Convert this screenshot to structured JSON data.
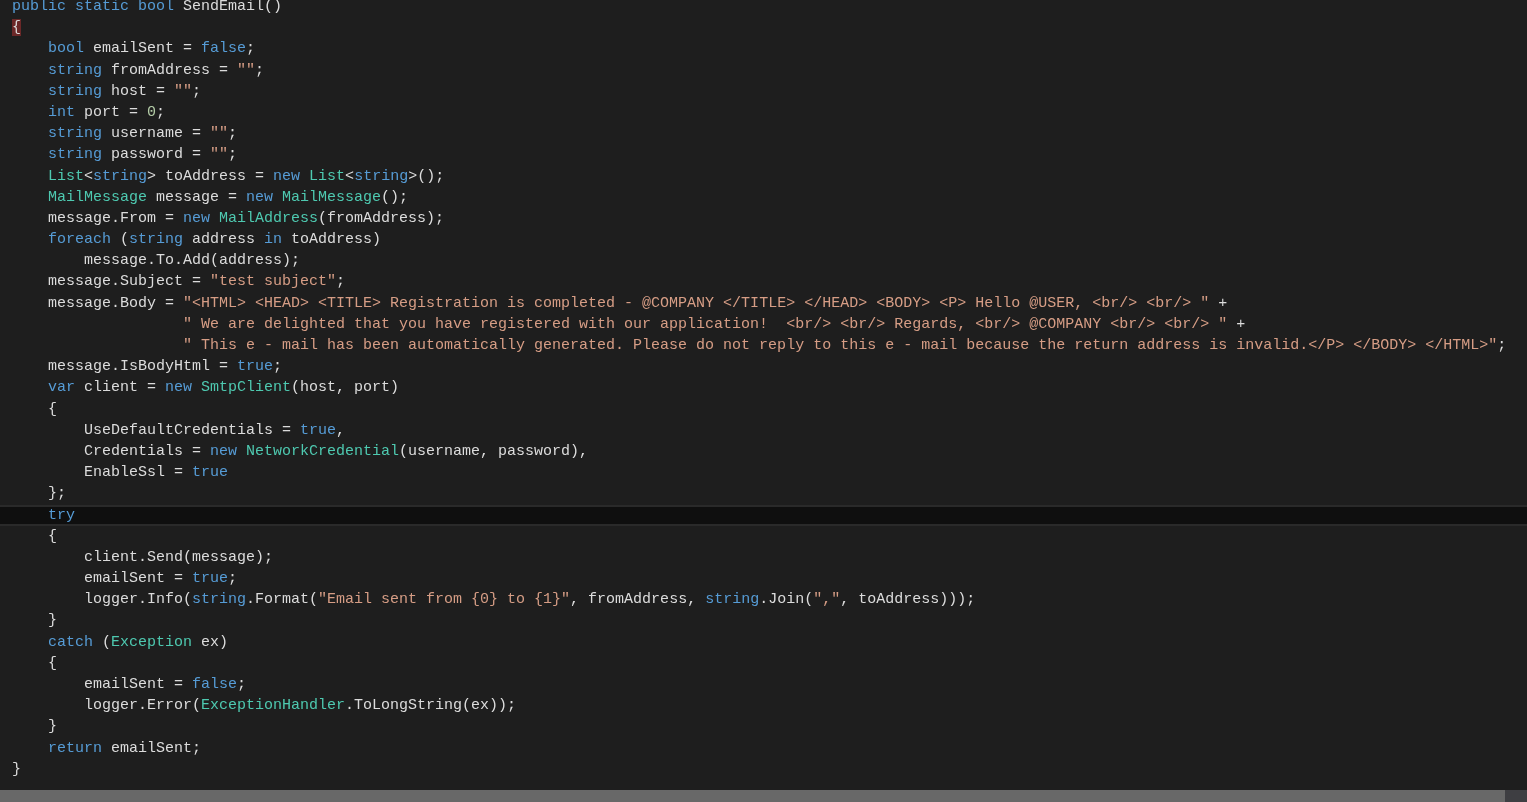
{
  "editor": {
    "lines": [
      {
        "current": false,
        "tokens": [
          {
            "kind": "keyword",
            "text": "public"
          },
          {
            "kind": "keyword",
            "text": " static"
          },
          {
            "kind": "keyword",
            "text": " bool"
          },
          {
            "kind": "plain",
            "text": " SendEmail()"
          }
        ]
      },
      {
        "current": false,
        "tokens": [
          {
            "kind": "plain",
            "text": "{",
            "matched": true
          }
        ]
      },
      {
        "current": false,
        "tokens": [
          {
            "kind": "keyword",
            "text": "    bool"
          },
          {
            "kind": "plain",
            "text": " emailSent = "
          },
          {
            "kind": "keyword",
            "text": "false"
          },
          {
            "kind": "plain",
            "text": ";"
          }
        ]
      },
      {
        "current": false,
        "tokens": [
          {
            "kind": "keyword",
            "text": "    string"
          },
          {
            "kind": "plain",
            "text": " fromAddress = "
          },
          {
            "kind": "string",
            "text": "\"\""
          },
          {
            "kind": "plain",
            "text": ";"
          }
        ]
      },
      {
        "current": false,
        "tokens": [
          {
            "kind": "keyword",
            "text": "    string"
          },
          {
            "kind": "plain",
            "text": " host = "
          },
          {
            "kind": "string",
            "text": "\"\""
          },
          {
            "kind": "plain",
            "text": ";"
          }
        ]
      },
      {
        "current": false,
        "tokens": [
          {
            "kind": "keyword",
            "text": "    int"
          },
          {
            "kind": "plain",
            "text": " port = "
          },
          {
            "kind": "number",
            "text": "0"
          },
          {
            "kind": "plain",
            "text": ";"
          }
        ]
      },
      {
        "current": false,
        "tokens": [
          {
            "kind": "keyword",
            "text": "    string"
          },
          {
            "kind": "plain",
            "text": " username = "
          },
          {
            "kind": "string",
            "text": "\"\""
          },
          {
            "kind": "plain",
            "text": ";"
          }
        ]
      },
      {
        "current": false,
        "tokens": [
          {
            "kind": "keyword",
            "text": "    string"
          },
          {
            "kind": "plain",
            "text": " password = "
          },
          {
            "kind": "string",
            "text": "\"\""
          },
          {
            "kind": "plain",
            "text": ";"
          }
        ]
      },
      {
        "current": false,
        "tokens": [
          {
            "kind": "type",
            "text": "    List"
          },
          {
            "kind": "plain",
            "text": "<"
          },
          {
            "kind": "keyword",
            "text": "string"
          },
          {
            "kind": "plain",
            "text": "> toAddress = "
          },
          {
            "kind": "keyword",
            "text": "new"
          },
          {
            "kind": "type",
            "text": " List"
          },
          {
            "kind": "plain",
            "text": "<"
          },
          {
            "kind": "keyword",
            "text": "string"
          },
          {
            "kind": "plain",
            "text": ">();"
          }
        ]
      },
      {
        "current": false,
        "tokens": [
          {
            "kind": "type",
            "text": "    MailMessage"
          },
          {
            "kind": "plain",
            "text": " message = "
          },
          {
            "kind": "keyword",
            "text": "new"
          },
          {
            "kind": "type",
            "text": " MailMessage"
          },
          {
            "kind": "plain",
            "text": "();"
          }
        ]
      },
      {
        "current": false,
        "tokens": [
          {
            "kind": "plain",
            "text": "    message.From = "
          },
          {
            "kind": "keyword",
            "text": "new"
          },
          {
            "kind": "type",
            "text": " MailAddress"
          },
          {
            "kind": "plain",
            "text": "(fromAddress);"
          }
        ]
      },
      {
        "current": false,
        "tokens": [
          {
            "kind": "keyword",
            "text": "    foreach"
          },
          {
            "kind": "plain",
            "text": " ("
          },
          {
            "kind": "keyword",
            "text": "string"
          },
          {
            "kind": "plain",
            "text": " address "
          },
          {
            "kind": "keyword",
            "text": "in"
          },
          {
            "kind": "plain",
            "text": " toAddress)"
          }
        ]
      },
      {
        "current": false,
        "tokens": [
          {
            "kind": "plain",
            "text": "        message.To.Add(address);"
          }
        ]
      },
      {
        "current": false,
        "tokens": [
          {
            "kind": "plain",
            "text": "    message.Subject = "
          },
          {
            "kind": "string",
            "text": "\"test subject\""
          },
          {
            "kind": "plain",
            "text": ";"
          }
        ]
      },
      {
        "current": false,
        "tokens": [
          {
            "kind": "plain",
            "text": "    message.Body = "
          },
          {
            "kind": "string",
            "text": "\"<HTML> <HEAD> <TITLE> Registration is completed - @COMPANY </TITLE> </HEAD> <BODY> <P> Hello @USER, <br/> <br/> \""
          },
          {
            "kind": "plain",
            "text": " +"
          }
        ]
      },
      {
        "current": false,
        "tokens": [
          {
            "kind": "string",
            "text": "                   \" We are delighted that you have registered with our application!  <br/> <br/> Regards, <br/> @COMPANY <br/> <br/> \""
          },
          {
            "kind": "plain",
            "text": " +"
          }
        ]
      },
      {
        "current": false,
        "tokens": [
          {
            "kind": "string",
            "text": "                   \" This e - mail has been automatically generated. Please do not reply to this e - mail because the return address is invalid.</P> </BODY> </HTML>\""
          },
          {
            "kind": "plain",
            "text": ";"
          }
        ]
      },
      {
        "current": false,
        "tokens": [
          {
            "kind": "plain",
            "text": "    message.IsBodyHtml = "
          },
          {
            "kind": "keyword",
            "text": "true"
          },
          {
            "kind": "plain",
            "text": ";"
          }
        ]
      },
      {
        "current": false,
        "tokens": [
          {
            "kind": "keyword",
            "text": "    var"
          },
          {
            "kind": "plain",
            "text": " client = "
          },
          {
            "kind": "keyword",
            "text": "new"
          },
          {
            "kind": "type",
            "text": " SmtpClient"
          },
          {
            "kind": "plain",
            "text": "(host, port)"
          }
        ]
      },
      {
        "current": false,
        "tokens": [
          {
            "kind": "plain",
            "text": "    {"
          }
        ]
      },
      {
        "current": false,
        "tokens": [
          {
            "kind": "plain",
            "text": "        UseDefaultCredentials = "
          },
          {
            "kind": "keyword",
            "text": "true"
          },
          {
            "kind": "plain",
            "text": ","
          }
        ]
      },
      {
        "current": false,
        "tokens": [
          {
            "kind": "plain",
            "text": "        Credentials = "
          },
          {
            "kind": "keyword",
            "text": "new"
          },
          {
            "kind": "type",
            "text": " NetworkCredential"
          },
          {
            "kind": "plain",
            "text": "(username, password),"
          }
        ]
      },
      {
        "current": false,
        "tokens": [
          {
            "kind": "plain",
            "text": "        EnableSsl = "
          },
          {
            "kind": "keyword",
            "text": "true"
          }
        ]
      },
      {
        "current": false,
        "tokens": [
          {
            "kind": "plain",
            "text": "    };"
          }
        ]
      },
      {
        "current": true,
        "tokens": [
          {
            "kind": "keyword",
            "text": "    try"
          }
        ]
      },
      {
        "current": false,
        "tokens": [
          {
            "kind": "plain",
            "text": "    {"
          }
        ]
      },
      {
        "current": false,
        "tokens": [
          {
            "kind": "plain",
            "text": "        client.Send(message);"
          }
        ]
      },
      {
        "current": false,
        "tokens": [
          {
            "kind": "plain",
            "text": "        emailSent = "
          },
          {
            "kind": "keyword",
            "text": "true"
          },
          {
            "kind": "plain",
            "text": ";"
          }
        ]
      },
      {
        "current": false,
        "tokens": [
          {
            "kind": "plain",
            "text": "        logger.Info("
          },
          {
            "kind": "keyword",
            "text": "string"
          },
          {
            "kind": "plain",
            "text": ".Format("
          },
          {
            "kind": "string",
            "text": "\"Email sent from {0} to {1}\""
          },
          {
            "kind": "plain",
            "text": ", fromAddress, "
          },
          {
            "kind": "keyword",
            "text": "string"
          },
          {
            "kind": "plain",
            "text": ".Join("
          },
          {
            "kind": "string",
            "text": "\",\""
          },
          {
            "kind": "plain",
            "text": ", toAddress)));"
          }
        ]
      },
      {
        "current": false,
        "tokens": [
          {
            "kind": "plain",
            "text": "    }"
          }
        ]
      },
      {
        "current": false,
        "tokens": [
          {
            "kind": "keyword",
            "text": "    catch"
          },
          {
            "kind": "plain",
            "text": " ("
          },
          {
            "kind": "type",
            "text": "Exception"
          },
          {
            "kind": "plain",
            "text": " ex)"
          }
        ]
      },
      {
        "current": false,
        "tokens": [
          {
            "kind": "plain",
            "text": "    {"
          }
        ]
      },
      {
        "current": false,
        "tokens": [
          {
            "kind": "plain",
            "text": "        emailSent = "
          },
          {
            "kind": "keyword",
            "text": "false"
          },
          {
            "kind": "plain",
            "text": ";"
          }
        ]
      },
      {
        "current": false,
        "tokens": [
          {
            "kind": "plain",
            "text": "        logger.Error("
          },
          {
            "kind": "type",
            "text": "ExceptionHandler"
          },
          {
            "kind": "plain",
            "text": ".ToLongString(ex));"
          }
        ]
      },
      {
        "current": false,
        "tokens": [
          {
            "kind": "plain",
            "text": "    }"
          }
        ]
      },
      {
        "current": false,
        "tokens": [
          {
            "kind": "keyword",
            "text": "    return"
          },
          {
            "kind": "plain",
            "text": " emailSent;"
          }
        ]
      },
      {
        "current": false,
        "tokens": [
          {
            "kind": "plain",
            "text": "}"
          }
        ]
      }
    ]
  }
}
